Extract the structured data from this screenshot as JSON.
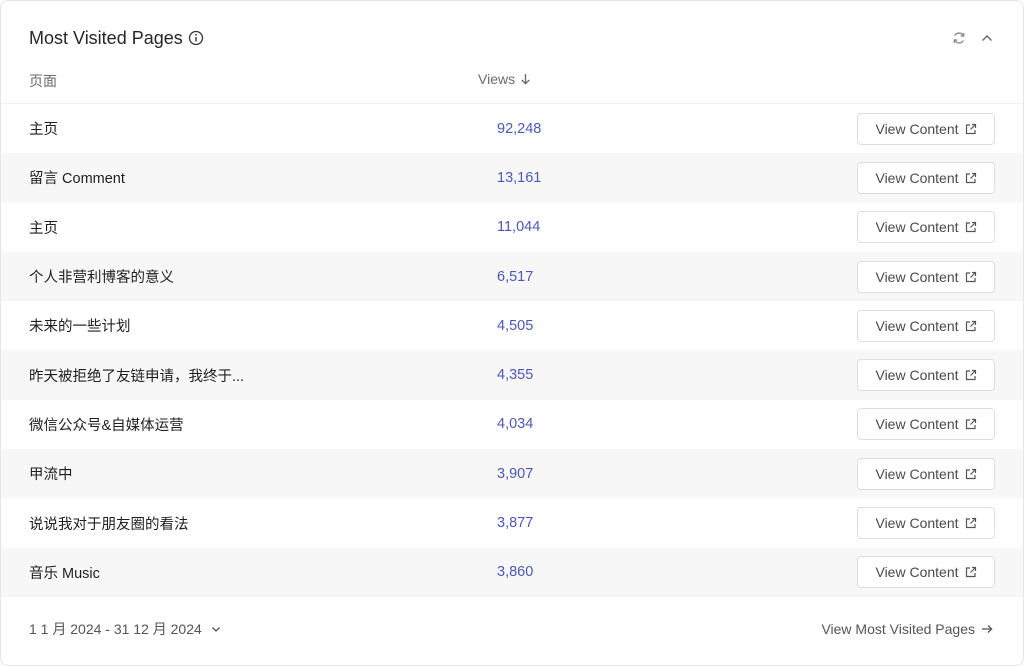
{
  "widget": {
    "title": "Most Visited Pages",
    "info_icon": "info-icon",
    "refresh_icon": "refresh-icon",
    "collapse_icon": "chevron-up-icon"
  },
  "columns": {
    "page": "页面",
    "views": "Views",
    "sort_icon": "arrow-down-icon"
  },
  "rows": [
    {
      "title": "主页",
      "views": "92,248",
      "action": "View Content"
    },
    {
      "title": "留言 Comment",
      "views": "13,161",
      "action": "View Content"
    },
    {
      "title": "主页",
      "views": "11,044",
      "action": "View Content"
    },
    {
      "title": "个人非营利博客的意义",
      "views": "6,517",
      "action": "View Content"
    },
    {
      "title": "未来的一些计划",
      "views": "4,505",
      "action": "View Content"
    },
    {
      "title": "昨天被拒绝了友链申请，我终于...",
      "views": "4,355",
      "action": "View Content"
    },
    {
      "title": "微信公众号&自媒体运营",
      "views": "4,034",
      "action": "View Content"
    },
    {
      "title": "甲流中",
      "views": "3,907",
      "action": "View Content"
    },
    {
      "title": "说说我对于朋友圈的看法",
      "views": "3,877",
      "action": "View Content"
    },
    {
      "title": "音乐 Music",
      "views": "3,860",
      "action": "View Content"
    }
  ],
  "footer": {
    "date_range": "1 1 月 2024 - 31 12 月 2024",
    "more_link": "View Most Visited Pages"
  },
  "colors": {
    "views_accent": "#4d57b8",
    "row_alt_bg": "#f7f7f7"
  }
}
